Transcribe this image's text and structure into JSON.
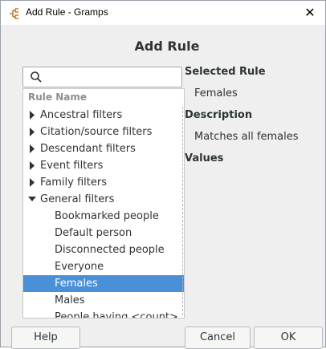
{
  "window": {
    "title": "Add Rule - Gramps",
    "close_glyph": "✕",
    "app_icon": "gramps-app-icon"
  },
  "dialog": {
    "title": "Add Rule"
  },
  "search": {
    "value": "",
    "placeholder": "",
    "icon": "search-icon"
  },
  "tree": {
    "column_header": "Rule Name",
    "rows": [
      {
        "label": "Ancestral filters",
        "type": "category",
        "expanded": false
      },
      {
        "label": "Citation/source filters",
        "type": "category",
        "expanded": false
      },
      {
        "label": "Descendant filters",
        "type": "category",
        "expanded": false
      },
      {
        "label": "Event filters",
        "type": "category",
        "expanded": false
      },
      {
        "label": "Family filters",
        "type": "category",
        "expanded": false
      },
      {
        "label": "General filters",
        "type": "category",
        "expanded": true
      },
      {
        "label": "Bookmarked people",
        "type": "rule"
      },
      {
        "label": "Default person",
        "type": "rule"
      },
      {
        "label": "Disconnected people",
        "type": "rule"
      },
      {
        "label": "Everyone",
        "type": "rule"
      },
      {
        "label": "Females",
        "type": "rule",
        "selected": true
      },
      {
        "label": "Males",
        "type": "rule"
      },
      {
        "label": "People having <count>...",
        "type": "rule",
        "partially_visible": true
      }
    ]
  },
  "details": {
    "selected_rule_title": "Selected Rule",
    "selected_rule_value": "Females",
    "description_title": "Description",
    "description_value": "Matches all females",
    "values_title": "Values"
  },
  "buttons": {
    "help": "Help",
    "cancel": "Cancel",
    "ok": "OK"
  },
  "colors": {
    "selection": "#4a90d9",
    "dialog_bg": "#efefef"
  }
}
